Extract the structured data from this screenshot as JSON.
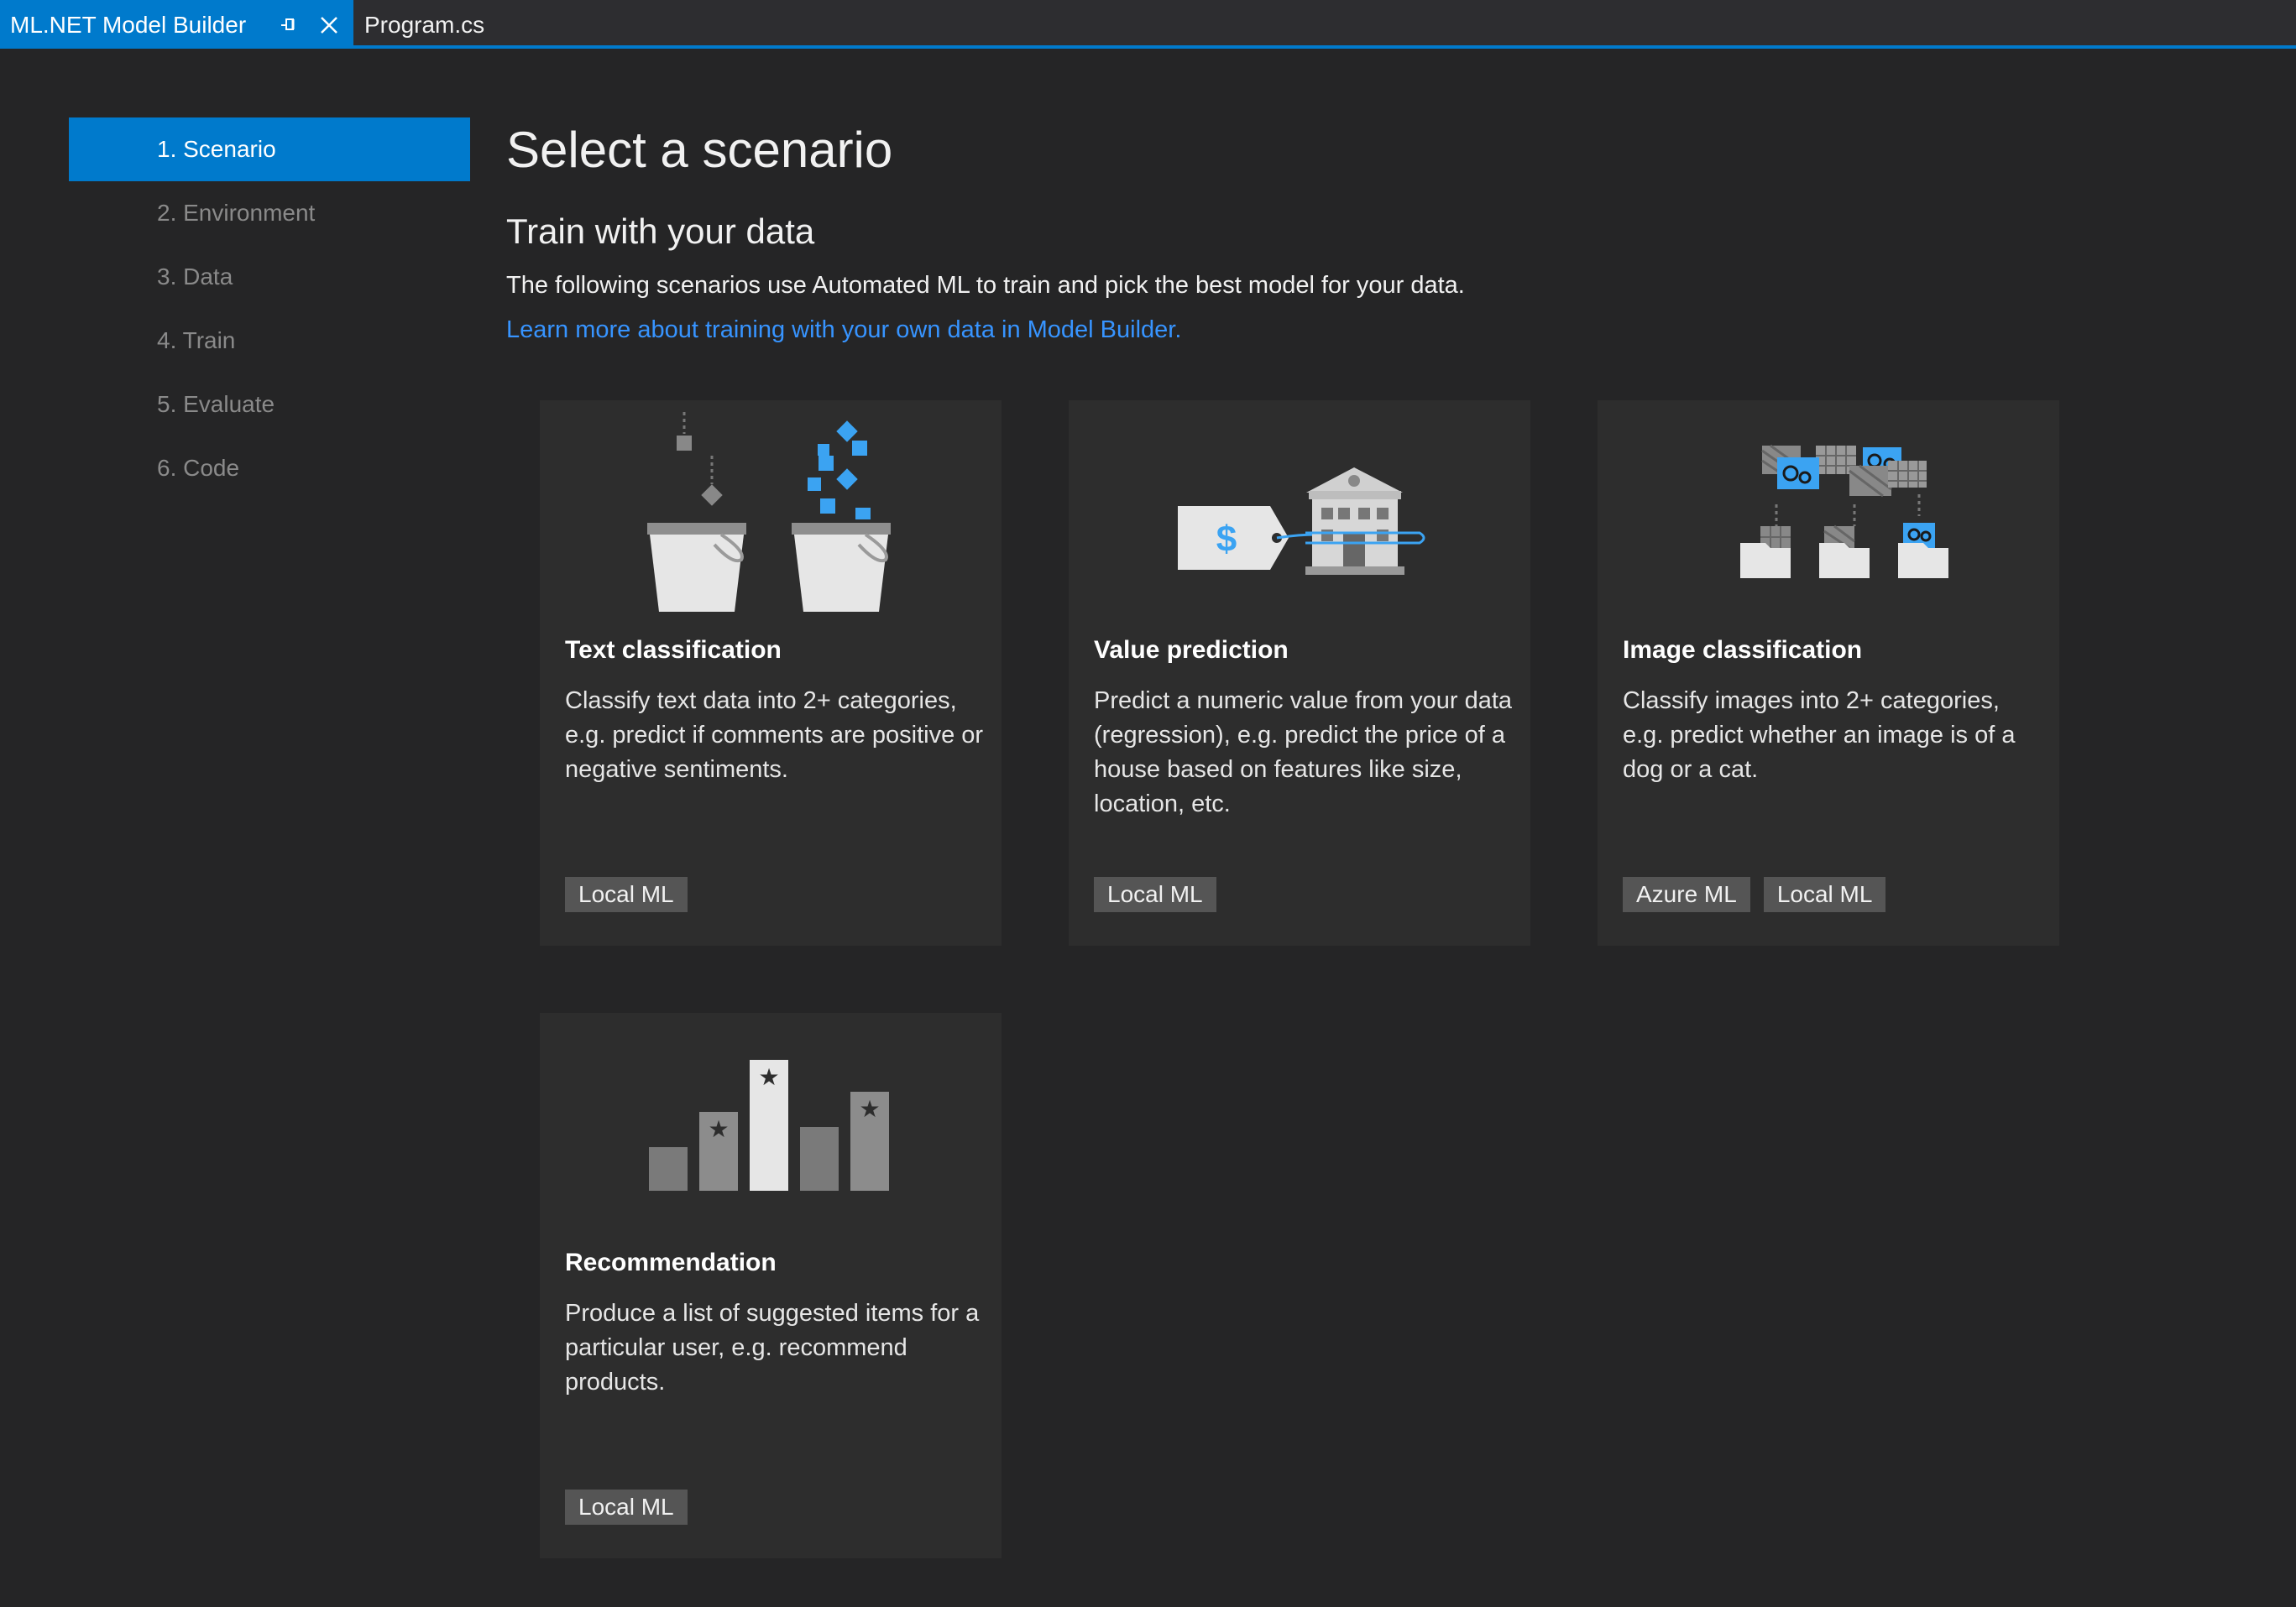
{
  "tabs": [
    {
      "label": "ML.NET Model Builder",
      "active": true
    },
    {
      "label": "Program.cs",
      "active": false
    }
  ],
  "sidebar": {
    "steps": [
      {
        "label": "1. Scenario",
        "active": true
      },
      {
        "label": "2. Environment",
        "active": false
      },
      {
        "label": "3. Data",
        "active": false
      },
      {
        "label": "4. Train",
        "active": false
      },
      {
        "label": "5. Evaluate",
        "active": false
      },
      {
        "label": "6. Code",
        "active": false
      }
    ]
  },
  "main": {
    "title": "Select a scenario",
    "subtitle": "Train with your data",
    "description": "The following scenarios use Automated ML to train and pick the best model for your data.",
    "link": "Learn more about training with your own data in Model Builder."
  },
  "cards": [
    {
      "title": "Text classification",
      "description": "Classify text data into 2+ categories, e.g. predict if comments are positive or negative sentiments.",
      "tags": [
        "Local ML"
      ],
      "icon": "buckets-icon"
    },
    {
      "title": "Value prediction",
      "description": "Predict a numeric value from your data (regression), e.g. predict the price of a house based on features like size, location, etc.",
      "tags": [
        "Local ML"
      ],
      "icon": "house-price-tag-icon",
      "price_symbol": "$"
    },
    {
      "title": "Image classification",
      "description": "Classify images into 2+ categories, e.g. predict whether an image is of a dog or a cat.",
      "tags": [
        "Azure ML",
        "Local ML"
      ],
      "icon": "image-sorting-icon"
    },
    {
      "title": "Recommendation",
      "description": "Produce a list of suggested items for a particular user, e.g. recommend products.",
      "tags": [
        "Local ML"
      ],
      "icon": "ranked-bars-icon"
    }
  ],
  "colors": {
    "accent": "#007acc",
    "link": "#3794ff",
    "icon_blue": "#3ba3f2",
    "card_bg": "#2d2d2d",
    "tag_bg": "#555555"
  }
}
